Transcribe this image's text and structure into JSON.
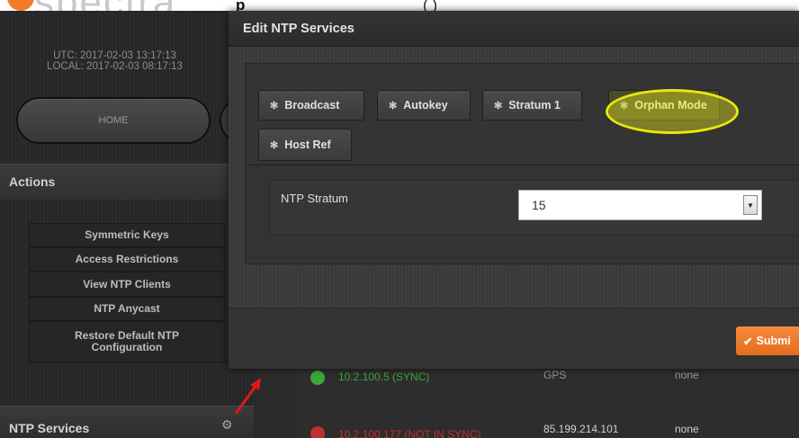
{
  "header": {
    "logo_text": "spectra",
    "title_partial": "p",
    "title_paren": "(                    )"
  },
  "sidebar": {
    "clock": {
      "utc": "UTC: 2017-02-03 13:17:13",
      "local": "LOCAL: 2017-02-03 08:17:13"
    },
    "home_label": "HOME",
    "actions_title": "Actions",
    "actions": [
      "Symmetric Keys",
      "Access Restrictions",
      "View NTP Clients",
      "NTP Anycast",
      "Restore Default NTP Configuration"
    ],
    "footer_title": "NTP Services"
  },
  "background_table": {
    "rows": [
      {
        "address": "10.2.100.5 (SYNC)",
        "ref": "GPS",
        "auth": "none",
        "status_color": "#3aa83a"
      },
      {
        "address": "10.2.100.177 (NOT IN SYNC)",
        "ref": "85.199.214.101",
        "auth": "none",
        "status_color": "#c03030"
      }
    ]
  },
  "modal": {
    "title": "Edit NTP Services",
    "tabs": [
      {
        "label": "Broadcast",
        "icon": "gear-icon"
      },
      {
        "label": "Autokey",
        "icon": "gear-icon"
      },
      {
        "label": "Stratum 1",
        "icon": "gear-icon"
      },
      {
        "label": "Orphan Mode",
        "icon": "gear-icon",
        "active": true
      },
      {
        "label": "Host Ref",
        "icon": "gear-icon"
      }
    ],
    "field": {
      "label": "NTP Stratum",
      "value": "15"
    },
    "submit_label": "Submi",
    "submit_icon": "checkmark-icon"
  },
  "colors": {
    "highlight": "#e8e80e",
    "submit": "#f07a2a",
    "sync_green": "#3aa83a",
    "nosync_red": "#c03030"
  }
}
